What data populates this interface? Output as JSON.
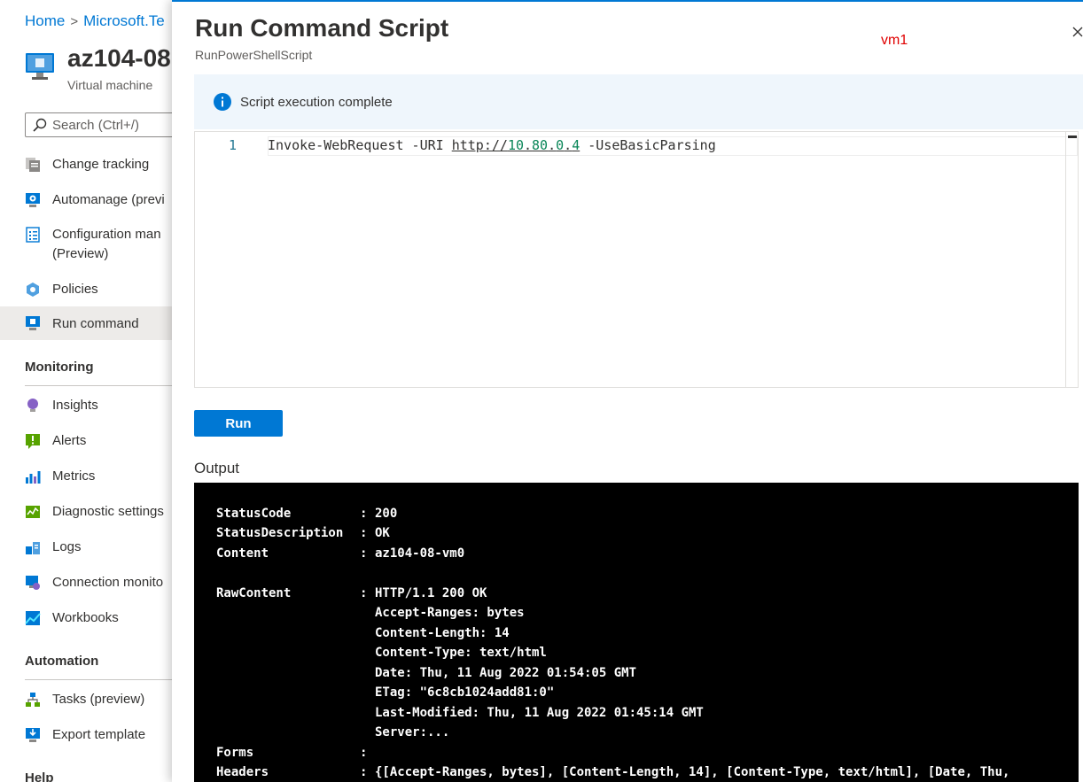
{
  "breadcrumb": {
    "home": "Home",
    "resource": "Microsoft.Te"
  },
  "vm": {
    "name": "az104-08",
    "type": "Virtual machine"
  },
  "search": {
    "placeholder": "Search (Ctrl+/)"
  },
  "nav": {
    "change_tracking": "Change tracking",
    "automanage": "Automanage (previ",
    "configuration_line1": "Configuration man",
    "configuration_line2": "(Preview)",
    "policies": "Policies",
    "run_command": "Run command",
    "monitoring_header": "Monitoring",
    "insights": "Insights",
    "alerts": "Alerts",
    "metrics": "Metrics",
    "diagnostic": "Diagnostic settings",
    "logs": "Logs",
    "connection": "Connection monito",
    "workbooks": "Workbooks",
    "automation_header": "Automation",
    "tasks": "Tasks (preview)",
    "export": "Export template",
    "help_header": "Help"
  },
  "panel": {
    "title": "Run Command Script",
    "subtitle": "RunPowerShellScript",
    "vm_annotation": "vm1",
    "info": "Script execution complete",
    "line_number": "1",
    "code": {
      "cmd": "Invoke-WebRequest -URI ",
      "url_prefix": "http://",
      "ip1": "10",
      "dot1": ".",
      "ip2": "80",
      "dot2": ".",
      "ip3": "0",
      "dot3": ".",
      "ip4": "4",
      "tail": " -UseBasicParsing"
    },
    "run_label": "Run",
    "output_label": "Output"
  },
  "output": {
    "rows": [
      {
        "key": "StatusCode",
        "value": "200"
      },
      {
        "key": "StatusDescription",
        "value": "OK"
      },
      {
        "key": "Content",
        "value": "az104-08-vm0"
      },
      {
        "key": "RawContent",
        "value": "HTTP/1.1 200 OK"
      },
      {
        "key": "Forms",
        "value": ""
      },
      {
        "key": "Headers",
        "value": "{[Accept-Ranges, bytes], [Content-Length, 14], [Content-Type, text/html], [Date, Thu,"
      }
    ],
    "raw_continuation": [
      "Accept-Ranges: bytes",
      "Content-Length: 14",
      "Content-Type: text/html",
      "Date: Thu, 11 Aug 2022 01:54:05 GMT",
      "ETag: \"6c8cb1024add81:0\"",
      "Last-Modified: Thu, 11 Aug 2022 01:45:14 GMT",
      "Server:..."
    ],
    "colon": ":"
  }
}
